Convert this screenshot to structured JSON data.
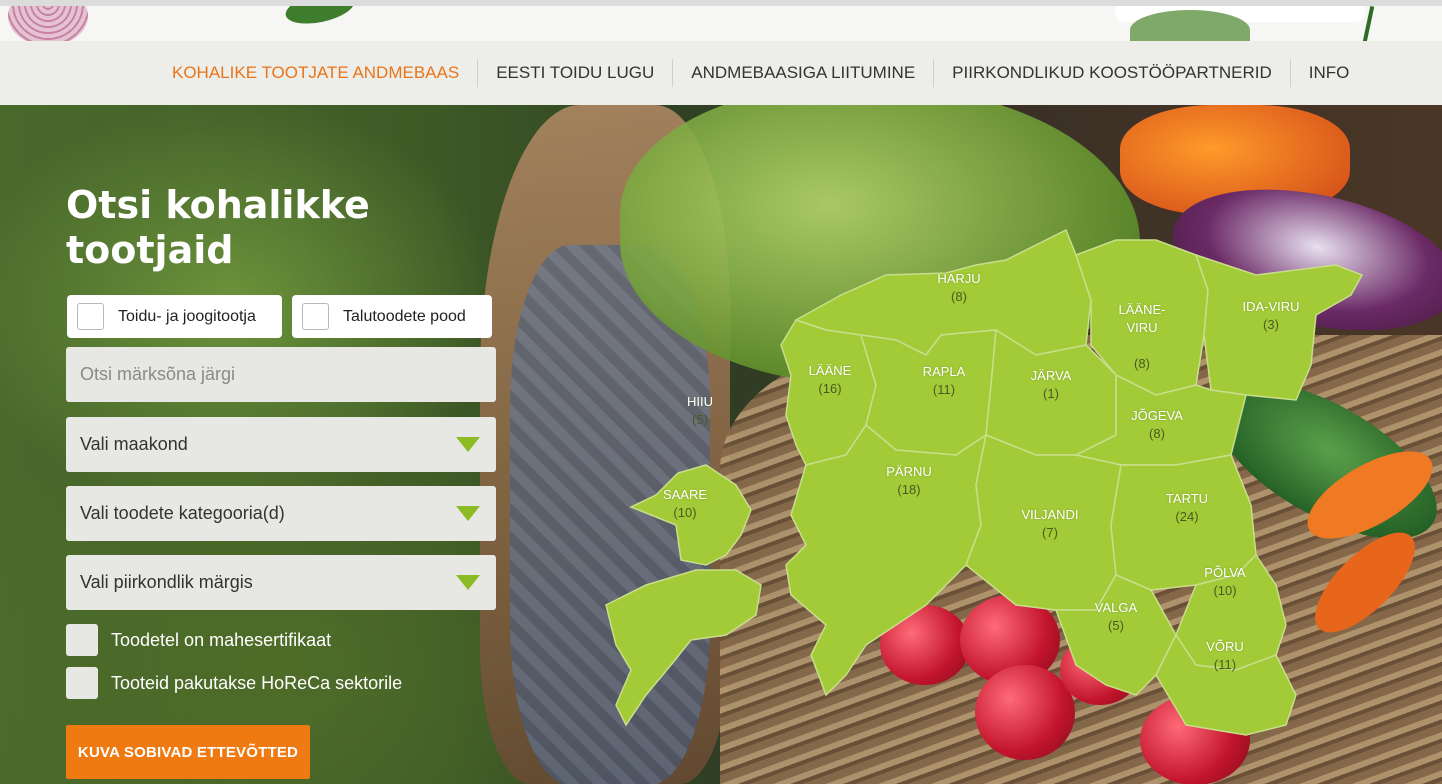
{
  "nav": {
    "items": [
      {
        "label": "KOHALIKE TOOTJATE ANDMEBAAS",
        "active": true
      },
      {
        "label": "EESTI TOIDU LUGU",
        "active": false
      },
      {
        "label": "ANDMEBAASIGA LIITUMINE",
        "active": false
      },
      {
        "label": "PIIRKONDLIKUD KOOSTÖÖPARTNERID",
        "active": false
      },
      {
        "label": "INFO",
        "active": false
      }
    ]
  },
  "search": {
    "heading": "Otsi kohalikke tootjaid",
    "type_checkboxes": [
      {
        "label": "Toidu- ja joogitootja",
        "checked": false
      },
      {
        "label": "Talutoodete pood",
        "checked": false
      }
    ],
    "keyword_placeholder": "Otsi märksõna järgi",
    "county_select": "Vali maakond",
    "category_select": "Vali toodete kategooria(d)",
    "mark_select": "Vali piirkondlik märgis",
    "options": [
      {
        "label": "Toodetel on mahesertifikaat",
        "checked": false
      },
      {
        "label": "Tooteid pakutakse HoReCa sektorile",
        "checked": false
      }
    ],
    "submit_label": "KUVA SOBIVAD ETTEVÕTTED"
  },
  "map": {
    "counties": [
      {
        "id": "harju",
        "name": "HARJU",
        "count": "(8)"
      },
      {
        "id": "laane-viru",
        "name": "LÄÄNE-\nVIRU",
        "count": "(8)"
      },
      {
        "id": "ida-viru",
        "name": "IDA-VIRU",
        "count": "(3)"
      },
      {
        "id": "hiiu",
        "name": "HIIU",
        "count": "(5)"
      },
      {
        "id": "laane",
        "name": "LÄÄNE",
        "count": "(16)"
      },
      {
        "id": "rapla",
        "name": "RAPLA",
        "count": "(11)"
      },
      {
        "id": "jarva",
        "name": "JÄRVA",
        "count": "(1)"
      },
      {
        "id": "jogeva",
        "name": "JÕGEVA",
        "count": "(8)"
      },
      {
        "id": "saare",
        "name": "SAARE",
        "count": "(10)"
      },
      {
        "id": "parnu",
        "name": "PÄRNU",
        "count": "(18)"
      },
      {
        "id": "viljandi",
        "name": "VILJANDI",
        "count": "(7)"
      },
      {
        "id": "tartu",
        "name": "TARTU",
        "count": "(24)"
      },
      {
        "id": "polva",
        "name": "PÕLVA",
        "count": "(10)"
      },
      {
        "id": "valga",
        "name": "VALGA",
        "count": "(5)"
      },
      {
        "id": "voru",
        "name": "VÕRU",
        "count": "(11)"
      }
    ]
  },
  "colors": {
    "accent": "#ee7a11",
    "nav_active": "#e8751a",
    "map_green": "#a3cb38",
    "caret_green": "#8cbc24"
  }
}
